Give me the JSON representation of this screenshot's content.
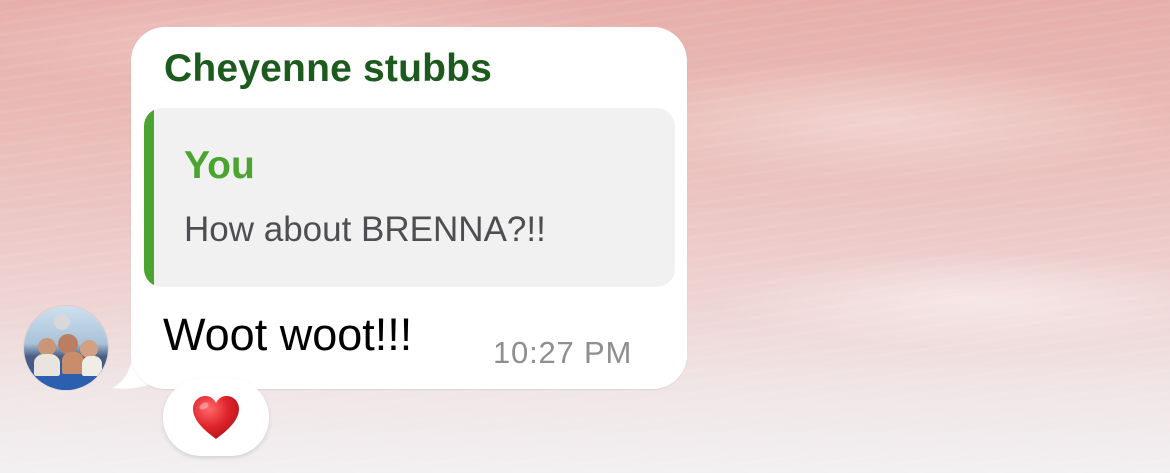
{
  "message": {
    "sender_name": "Cheyenne stubbs",
    "reply_quote": {
      "author": "You",
      "text": "How about BRENNA?!!"
    },
    "text": "Woot woot!!!",
    "time": "10:27 PM",
    "reaction": {
      "emoji": "❤️",
      "icon": "red-heart-icon"
    }
  },
  "colors": {
    "sender_name": "#1d5a1e",
    "quote_accent": "#4aa42f",
    "quote_background": "#f1f1f2",
    "timestamp": "#8e8e93",
    "bubble": "#ffffff",
    "heart": "#e0242c"
  }
}
